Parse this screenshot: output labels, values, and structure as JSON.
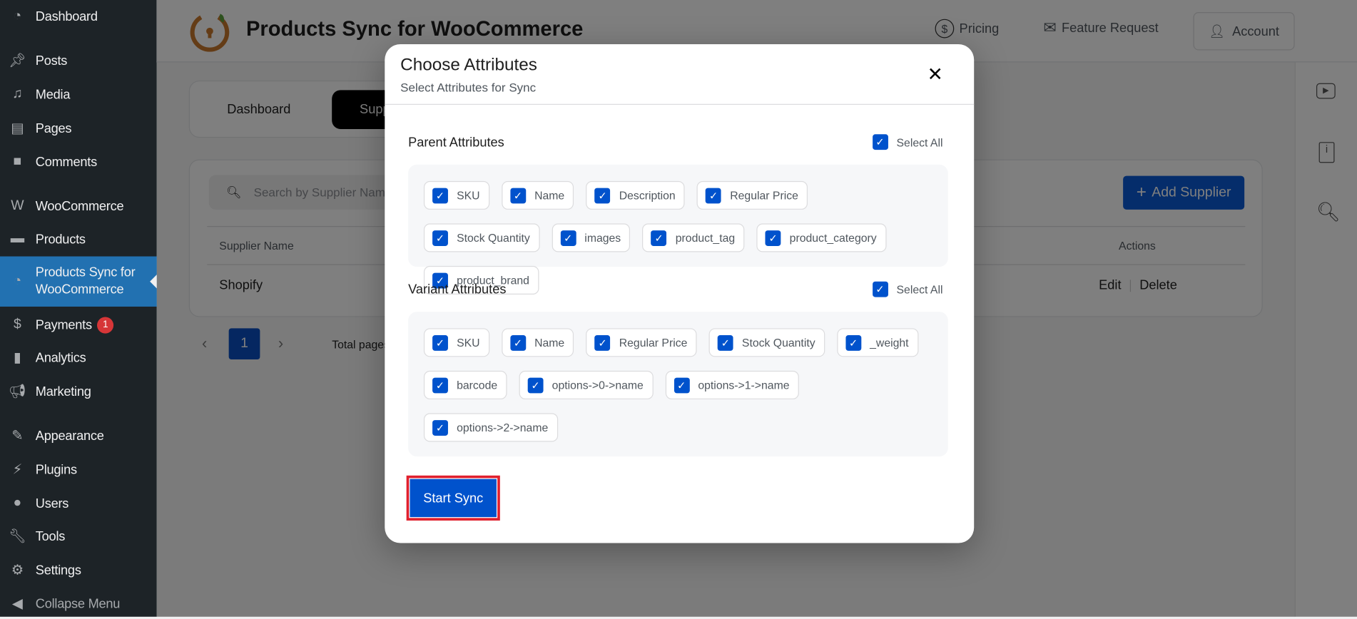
{
  "sidebar": {
    "items": [
      {
        "label": "Dashboard",
        "icon": "dashboard-icon"
      },
      {
        "label": "Posts",
        "icon": "pin-icon"
      },
      {
        "label": "Media",
        "icon": "media-icon"
      },
      {
        "label": "Pages",
        "icon": "pages-icon"
      },
      {
        "label": "Comments",
        "icon": "comment-icon"
      },
      {
        "label": "WooCommerce",
        "icon": "woocommerce-icon"
      },
      {
        "label": "Products",
        "icon": "archive-icon"
      },
      {
        "label": "Products Sync for WooCommerce",
        "icon": "sync-logo-icon",
        "active": true
      },
      {
        "label": "Payments",
        "icon": "dollar-icon",
        "badge": "1"
      },
      {
        "label": "Analytics",
        "icon": "bar-chart-icon"
      },
      {
        "label": "Marketing",
        "icon": "megaphone-icon"
      },
      {
        "label": "Appearance",
        "icon": "brush-icon"
      },
      {
        "label": "Plugins",
        "icon": "plug-icon"
      },
      {
        "label": "Users",
        "icon": "user-icon"
      },
      {
        "label": "Tools",
        "icon": "wrench-icon"
      },
      {
        "label": "Settings",
        "icon": "sliders-icon"
      },
      {
        "label": "Collapse Menu",
        "icon": "collapse-icon"
      }
    ]
  },
  "header": {
    "title": "Products Sync for WooCommerce",
    "pricing": "Pricing",
    "feature_request": "Feature Request",
    "account": "Account"
  },
  "tabs": [
    {
      "label": "Dashboard"
    },
    {
      "label": "Suppliers",
      "active": true
    }
  ],
  "suppliers": {
    "search_placeholder": "Search by Supplier Name",
    "add_button": "Add Supplier",
    "columns": [
      "Supplier Name",
      "Actions"
    ],
    "rows": [
      {
        "name": "Shopify",
        "edit": "Edit",
        "delete": "Delete"
      }
    ],
    "pagination": {
      "current": "1",
      "total_label": "Total pages"
    }
  },
  "modal": {
    "title": "Choose Attributes",
    "subtitle": "Select Attributes for Sync",
    "parent": {
      "title": "Parent Attributes",
      "select_all": "Select All",
      "items": [
        "SKU",
        "Name",
        "Description",
        "Regular Price",
        "Stock Quantity",
        "images",
        "product_tag",
        "product_category",
        "product_brand"
      ]
    },
    "variant": {
      "title": "Variant Attributes",
      "select_all": "Select All",
      "items": [
        "SKU",
        "Name",
        "Regular Price",
        "Stock Quantity",
        "_weight",
        "barcode",
        "options->0->name",
        "options->1->name",
        "options->2->name"
      ]
    },
    "start_sync": "Start Sync"
  },
  "colors": {
    "accent": "#0052cc",
    "sidebar": "#1d2327",
    "active": "#2271b1",
    "highlight_border": "#e0202e"
  }
}
